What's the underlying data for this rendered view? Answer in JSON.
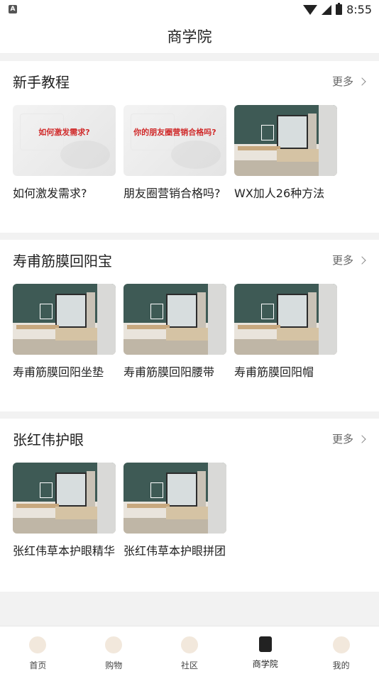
{
  "status": {
    "time": "8:55",
    "notif": "A"
  },
  "header": {
    "title": "商学院"
  },
  "sections": [
    {
      "title": "新手教程",
      "more": "更多",
      "cards": [
        {
          "label": "如何激发需求?",
          "thumb": "poster",
          "poster_text": "如何激发需求?"
        },
        {
          "label": "朋友圈营销合格吗?",
          "thumb": "poster",
          "poster_text": "你的朋友圈营销合格吗?"
        },
        {
          "label": "WX加人26种方法",
          "thumb": "room"
        }
      ]
    },
    {
      "title": "寿甫筋膜回阳宝",
      "more": "更多",
      "cards": [
        {
          "label": "寿甫筋膜回阳坐垫",
          "thumb": "room"
        },
        {
          "label": "寿甫筋膜回阳腰带",
          "thumb": "room"
        },
        {
          "label": "寿甫筋膜回阳帽",
          "thumb": "room"
        }
      ]
    },
    {
      "title": "张红伟护眼",
      "more": "更多",
      "cards": [
        {
          "label": "张红伟草本护眼精华",
          "thumb": "room"
        },
        {
          "label": "张红伟草本护眼拼团",
          "thumb": "room"
        }
      ]
    }
  ],
  "tabs": [
    {
      "label": "首页",
      "icon": "home-icon"
    },
    {
      "label": "购物",
      "icon": "shopping-bag-icon"
    },
    {
      "label": "社区",
      "icon": "community-icon"
    },
    {
      "label": "商学院",
      "icon": "book-icon",
      "active": true
    },
    {
      "label": "我的",
      "icon": "profile-icon"
    }
  ]
}
